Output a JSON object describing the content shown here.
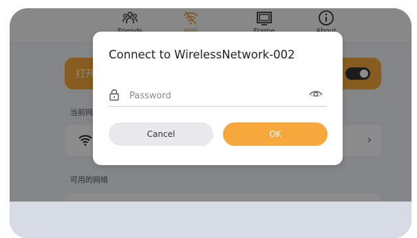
{
  "nav": {
    "items": [
      {
        "label": "Friends",
        "icon": "friends-icon"
      },
      {
        "label": "WiFi",
        "icon": "wifi-off-icon",
        "active": true
      },
      {
        "label": "Frame",
        "icon": "frame-icon"
      },
      {
        "label": "About",
        "icon": "info-icon"
      }
    ]
  },
  "main": {
    "wifi_toggle_label": "打开",
    "wifi_toggle_on": true,
    "current_network_label": "当前网络",
    "available_networks_label": "可用的网络"
  },
  "dialog": {
    "title": "Connect to WirelessNetwork-002",
    "password_placeholder": "Password",
    "password_value": "",
    "cancel_label": "Cancel",
    "ok_label": "OK"
  },
  "colors": {
    "accent": "#f6a83a",
    "overlay": "rgba(0,0,0,0.45)"
  }
}
